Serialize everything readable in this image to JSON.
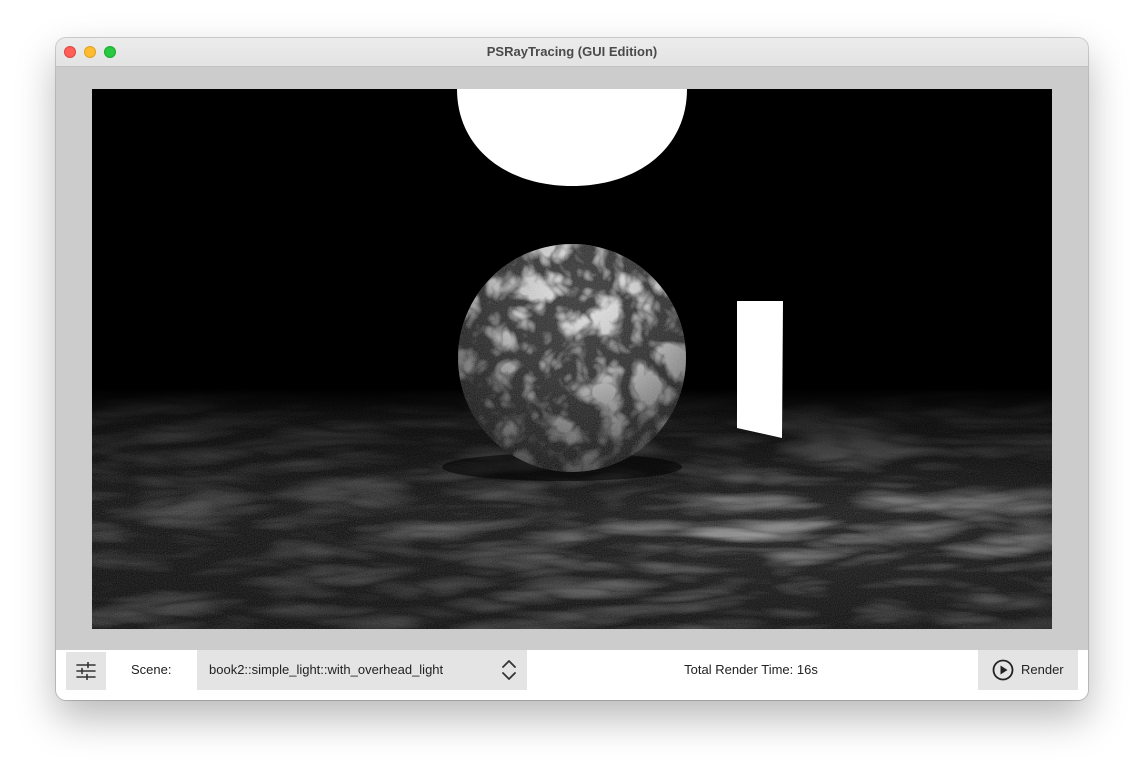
{
  "window": {
    "title": "PSRayTracing (GUI Edition)"
  },
  "toolbar": {
    "settings_icon": "sliders-icon",
    "scene_label": "Scene:",
    "scene_value": "book2::simple_light::with_overhead_light",
    "render_time": "Total Render Time: 16s",
    "render_label": "Render",
    "render_icon": "play-circle-icon"
  },
  "colors": {
    "close": "#ff5f57",
    "minimize": "#febc2e",
    "maximize": "#28c840",
    "control_bg": "#e4e4e4",
    "window_bg": "#cccccc"
  }
}
